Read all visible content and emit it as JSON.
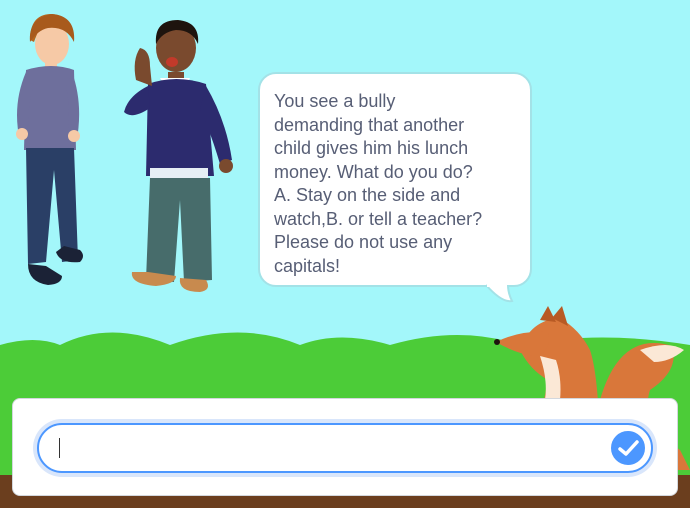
{
  "stage": {
    "speech_text": "You see a bully\ndemanding that another\nchild gives him his lunch\nmoney. What do you do?\nA. Stay on the side and\nwatch,B. or tell a teacher?\nPlease do not use any\ncapitals!"
  },
  "ask_prompt": {
    "answer_value": "",
    "submit_icon": "checkmark-icon"
  },
  "colors": {
    "sky": "#a3f7fa",
    "grass": "#4ccc38",
    "ground": "#6b3e1e",
    "accent": "#4c97ff",
    "text": "#575e75"
  }
}
